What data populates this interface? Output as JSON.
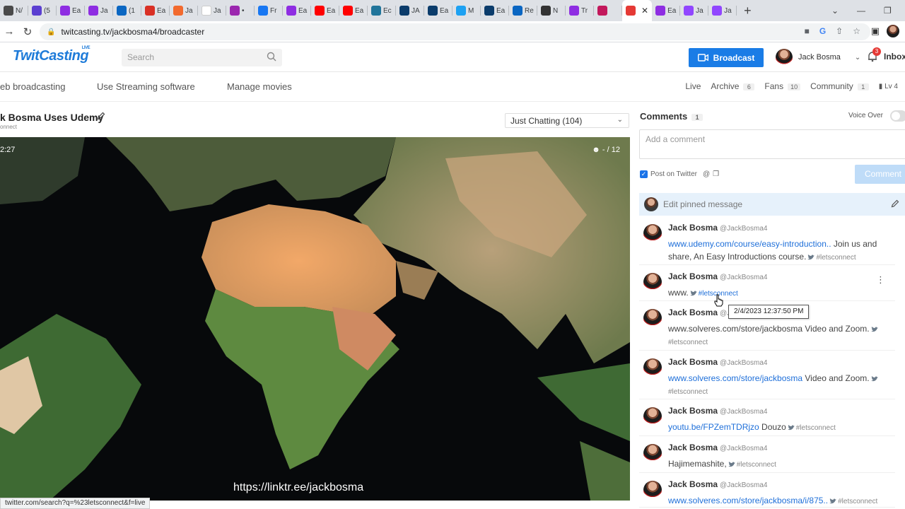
{
  "browser": {
    "tabs": [
      {
        "label": "N/",
        "color": "#4a4a4a"
      },
      {
        "label": "(5",
        "color": "#5b3fd1"
      },
      {
        "label": "Ea",
        "color": "#8e2de2"
      },
      {
        "label": "Ja",
        "color": "#8e2de2"
      },
      {
        "label": "(1",
        "color": "#0a66c2"
      },
      {
        "label": "Ea",
        "color": "#d93025"
      },
      {
        "label": "Ja",
        "color": "#f26a2e"
      },
      {
        "label": "Ja",
        "color": "#ffffff"
      },
      {
        "label": "•",
        "color": "#9b27af"
      },
      {
        "label": "Fr",
        "color": "#1877f2"
      },
      {
        "label": "Ea",
        "color": "#8e2de2"
      },
      {
        "label": "Ea",
        "color": "#ff0000"
      },
      {
        "label": "Ea",
        "color": "#ff0000"
      },
      {
        "label": "Ec",
        "color": "#21759b"
      },
      {
        "label": "JA",
        "color": "#0b3c6b"
      },
      {
        "label": "Ea",
        "color": "#0b3c6b"
      },
      {
        "label": "M",
        "color": "#1da1f2"
      },
      {
        "label": "Ea",
        "color": "#0b3c6b"
      },
      {
        "label": "Re",
        "color": "#0a66c2"
      },
      {
        "label": "N",
        "color": "#333333"
      },
      {
        "label": "Tr",
        "color": "#8e2de2"
      },
      {
        "label": "",
        "color": "#c2185b"
      },
      {
        "label": "",
        "color": "#e53935",
        "active": true
      },
      {
        "label": "Ea",
        "color": "#8e2de2"
      },
      {
        "label": "Ja",
        "color": "#9146ff"
      },
      {
        "label": "Ja",
        "color": "#9146ff"
      }
    ],
    "url": "twitcasting.tv/jackbosma4/broadcaster",
    "status_url": "twitter.com/search?q=%23letsconnect&f=live"
  },
  "header": {
    "logo": "TwitCasting",
    "logo_live": "LIVE",
    "search_placeholder": "Search",
    "broadcast_label": "Broadcast",
    "user_name": "Jack Bosma",
    "notification_count": "3",
    "inbox_label": "Inbox"
  },
  "subnav": {
    "left": [
      "eb broadcasting",
      "Use Streaming software",
      "Manage movies"
    ],
    "live": "Live",
    "archive": "Archive",
    "archive_count": "6",
    "fans": "Fans",
    "fans_count": "10",
    "community": "Community",
    "community_count": "1",
    "level": "Lv 4"
  },
  "stream": {
    "title": "k Bosma Uses Udemy",
    "subtitle": "onnect",
    "category": "Just Chatting (104)",
    "time": "2:27",
    "viewers": "- / 12",
    "overlay_url": "https://linktr.ee/jackbosma"
  },
  "comments": {
    "title": "Comments",
    "count": "1",
    "voice_over": "Voice Over",
    "placeholder": "Add a comment",
    "post_on_twitter": "Post on Twitter",
    "comment_button": "Comment",
    "pinned_placeholder": "Edit pinned message",
    "tooltip": "2/4/2023 12:37:50 PM",
    "items": [
      {
        "name": "Jack Bosma",
        "handle": "@JackBosma4",
        "link": "www.udemy.com/course/easy-introduction..",
        "text": " Join us and share, An Easy Introductions course.",
        "tag": "#letsconnect"
      },
      {
        "name": "Jack Bosma",
        "handle": "@JackBosma4",
        "link": "",
        "text": "www.",
        "tag": "#letsconnect"
      },
      {
        "name": "Jack Bosma",
        "handle": "@Ja",
        "link": "",
        "text": "www.solveres.com/store/jackbosma  Video and Zoom.",
        "tag": "#letsconnect"
      },
      {
        "name": "Jack Bosma",
        "handle": "@JackBosma4",
        "link": "www.solveres.com/store/jackbosma",
        "text": "  Video and Zoom.",
        "tag": "#letsconnect"
      },
      {
        "name": "Jack Bosma",
        "handle": "@JackBosma4",
        "link": "youtu.be/FPZemTDRjzo",
        "text": " Douzo",
        "tag": "#letsconnect"
      },
      {
        "name": "Jack Bosma",
        "handle": "@JackBosma4",
        "link": "",
        "text": "Hajimemashite,",
        "tag": "#letsconnect"
      },
      {
        "name": "Jack Bosma",
        "handle": "@JackBosma4",
        "link": "www.solveres.com/store/jackbosma/i/875..",
        "text": "",
        "tag": "#letsconnect"
      }
    ]
  }
}
